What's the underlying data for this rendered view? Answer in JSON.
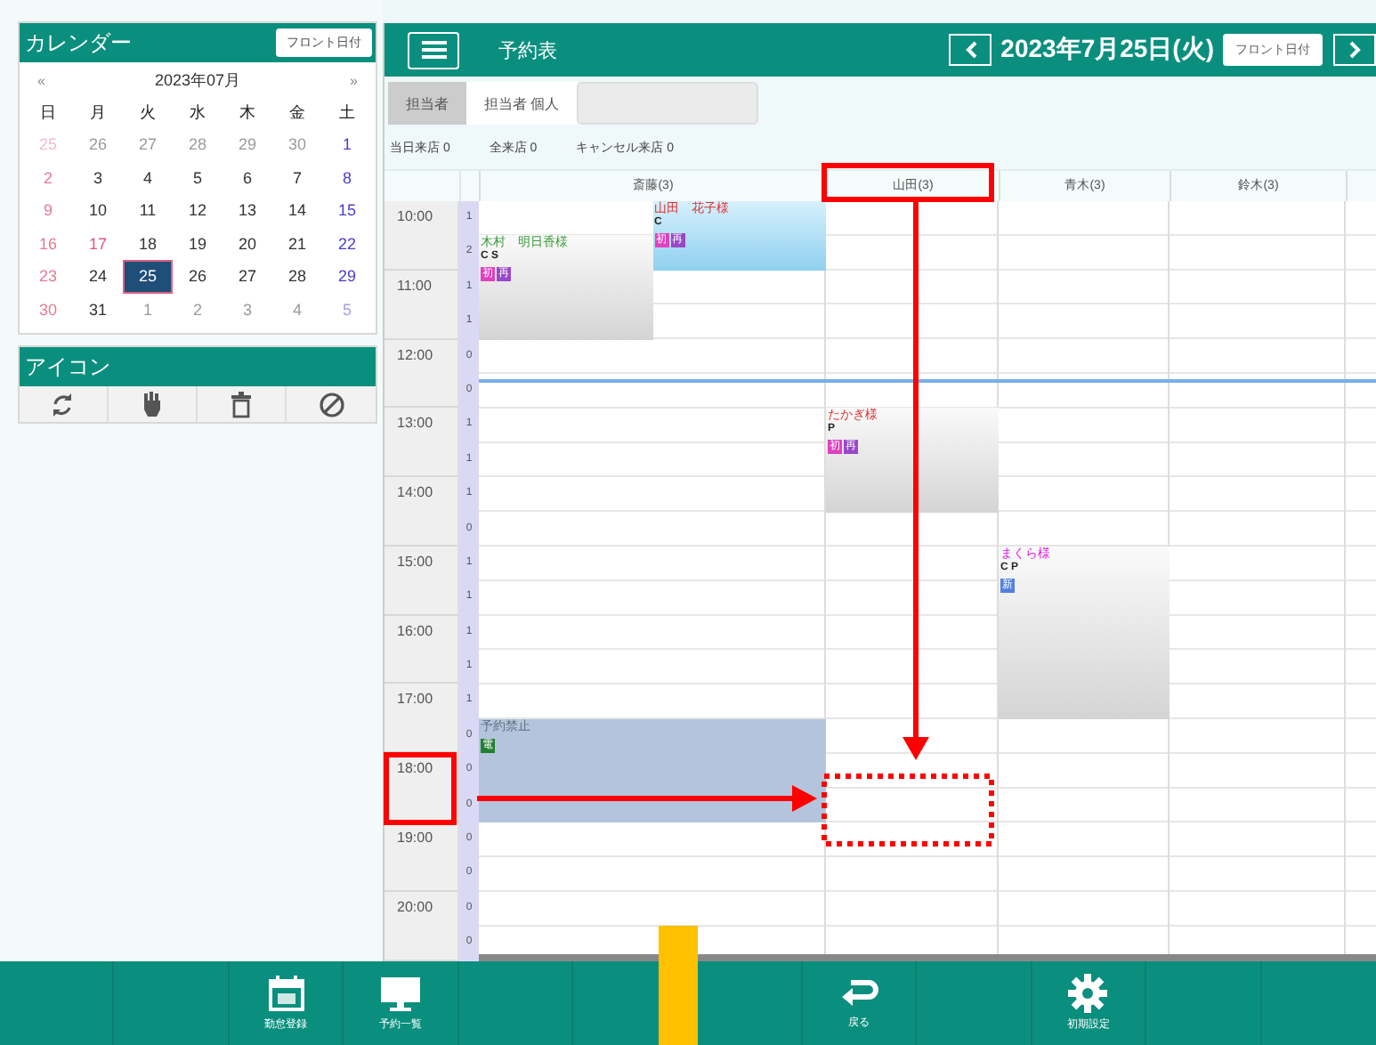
{
  "calendar": {
    "title": "カレンダー",
    "today_button": "フロント日付",
    "prev": "«",
    "next": "»",
    "month": "2023年07月",
    "weekdays": [
      "日",
      "月",
      "火",
      "水",
      "木",
      "金",
      "土"
    ],
    "days": [
      {
        "label": "25",
        "kind": "sun",
        "muted": true,
        "selected": false
      },
      {
        "label": "26",
        "kind": "weekday",
        "muted": true,
        "selected": false
      },
      {
        "label": "27",
        "kind": "weekday",
        "muted": true,
        "selected": false
      },
      {
        "label": "28",
        "kind": "weekday",
        "muted": true,
        "selected": false
      },
      {
        "label": "29",
        "kind": "weekday",
        "muted": true,
        "selected": false
      },
      {
        "label": "30",
        "kind": "weekday",
        "muted": true,
        "selected": false
      },
      {
        "label": "1",
        "kind": "sat",
        "muted": false,
        "selected": false
      },
      {
        "label": "2",
        "kind": "sun",
        "muted": false,
        "selected": false
      },
      {
        "label": "3",
        "kind": "weekday",
        "muted": false,
        "selected": false
      },
      {
        "label": "4",
        "kind": "weekday",
        "muted": false,
        "selected": false
      },
      {
        "label": "5",
        "kind": "weekday",
        "muted": false,
        "selected": false
      },
      {
        "label": "6",
        "kind": "weekday",
        "muted": false,
        "selected": false
      },
      {
        "label": "7",
        "kind": "weekday",
        "muted": false,
        "selected": false
      },
      {
        "label": "8",
        "kind": "sat",
        "muted": false,
        "selected": false
      },
      {
        "label": "9",
        "kind": "sun",
        "muted": false,
        "selected": false
      },
      {
        "label": "10",
        "kind": "weekday",
        "muted": false,
        "selected": false
      },
      {
        "label": "11",
        "kind": "weekday",
        "muted": false,
        "selected": false
      },
      {
        "label": "12",
        "kind": "weekday",
        "muted": false,
        "selected": false
      },
      {
        "label": "13",
        "kind": "weekday",
        "muted": false,
        "selected": false
      },
      {
        "label": "14",
        "kind": "weekday",
        "muted": false,
        "selected": false
      },
      {
        "label": "15",
        "kind": "sat",
        "muted": false,
        "selected": false
      },
      {
        "label": "16",
        "kind": "sun",
        "muted": false,
        "selected": false
      },
      {
        "label": "17",
        "kind": "holiday",
        "muted": false,
        "selected": false
      },
      {
        "label": "18",
        "kind": "weekday",
        "muted": false,
        "selected": false
      },
      {
        "label": "19",
        "kind": "weekday",
        "muted": false,
        "selected": false
      },
      {
        "label": "20",
        "kind": "weekday",
        "muted": false,
        "selected": false
      },
      {
        "label": "21",
        "kind": "weekday",
        "muted": false,
        "selected": false
      },
      {
        "label": "22",
        "kind": "sat",
        "muted": false,
        "selected": false
      },
      {
        "label": "23",
        "kind": "sun",
        "muted": false,
        "selected": false
      },
      {
        "label": "24",
        "kind": "weekday",
        "muted": false,
        "selected": false
      },
      {
        "label": "25",
        "kind": "weekday",
        "muted": false,
        "selected": true
      },
      {
        "label": "26",
        "kind": "weekday",
        "muted": false,
        "selected": false
      },
      {
        "label": "27",
        "kind": "weekday",
        "muted": false,
        "selected": false
      },
      {
        "label": "28",
        "kind": "weekday",
        "muted": false,
        "selected": false
      },
      {
        "label": "29",
        "kind": "sat",
        "muted": false,
        "selected": false
      },
      {
        "label": "30",
        "kind": "sun",
        "muted": false,
        "selected": false
      },
      {
        "label": "31",
        "kind": "weekday",
        "muted": false,
        "selected": false
      },
      {
        "label": "1",
        "kind": "weekday",
        "muted": true,
        "selected": false
      },
      {
        "label": "2",
        "kind": "weekday",
        "muted": true,
        "selected": false
      },
      {
        "label": "3",
        "kind": "weekday",
        "muted": true,
        "selected": false
      },
      {
        "label": "4",
        "kind": "weekday",
        "muted": true,
        "selected": false
      },
      {
        "label": "5",
        "kind": "sat",
        "muted": true,
        "selected": false
      }
    ]
  },
  "icon_panel": {
    "title": "アイコン",
    "icons": [
      {
        "kind": "refresh"
      },
      {
        "kind": "hand"
      },
      {
        "kind": "trash"
      },
      {
        "kind": "block"
      }
    ]
  },
  "header": {
    "title": "予約表",
    "date": "2023年7月25日(火)",
    "today_button": "フロント日付"
  },
  "tabs": [
    {
      "label": "担当者",
      "selected": true
    },
    {
      "label": "担当者 個人",
      "selected": false
    }
  ],
  "counts": [
    {
      "label": "当日来店",
      "value": "0"
    },
    {
      "label": "全来店",
      "value": "0"
    },
    {
      "label": "キャンセル来店",
      "value": "0"
    }
  ],
  "columns": [
    "斎藤(3)",
    "山田(3)",
    "青木(3)",
    "鈴木(3)"
  ],
  "rows": [
    {
      "time": "10:00",
      "count": "1"
    },
    {
      "count": "2"
    },
    {
      "time": "11:00",
      "count": "1"
    },
    {
      "count": "1"
    },
    {
      "time": "12:00",
      "count": "0"
    },
    {
      "count": "0"
    },
    {
      "time": "13:00",
      "count": "1"
    },
    {
      "count": "1"
    },
    {
      "time": "14:00",
      "count": "1"
    },
    {
      "count": "0"
    },
    {
      "time": "15:00",
      "count": "1"
    },
    {
      "count": "1"
    },
    {
      "time": "16:00",
      "count": "1"
    },
    {
      "count": "1"
    },
    {
      "time": "17:00",
      "count": "1"
    },
    {
      "count": "0"
    },
    {
      "time": "18:00",
      "count": "0"
    },
    {
      "count": "0"
    },
    {
      "time": "19:00",
      "count": "0"
    },
    {
      "count": "0"
    },
    {
      "time": "20:00",
      "count": "0"
    },
    {
      "count": "0"
    }
  ],
  "appointments": [
    {
      "kind": "reserved",
      "name": "木村　明日香様",
      "color": "#3c9a3c",
      "tags": "C S",
      "badges": [
        {
          "label": "初",
          "color": "#e040c0"
        },
        {
          "label": "再",
          "color": "#9848c8"
        }
      ]
    },
    {
      "kind": "current",
      "name": "山田　花子様",
      "color": "#e03030",
      "tags": "C",
      "badges": [
        {
          "label": "初",
          "color": "#e040c0"
        },
        {
          "label": "再",
          "color": "#9848c8"
        }
      ]
    },
    {
      "kind": "reserved",
      "name": "たかぎ様",
      "color": "#e03030",
      "tags": "P",
      "badges": [
        {
          "label": "初",
          "color": "#e040c0"
        },
        {
          "label": "再",
          "color": "#9848c8"
        }
      ]
    },
    {
      "kind": "reserved",
      "name": "まくら様",
      "color": "#e020e0",
      "tags": "C P",
      "badges": [
        {
          "label": "新",
          "color": "#5080e0"
        }
      ]
    },
    {
      "kind": "blocked",
      "name": "予約禁止",
      "color": "#607080",
      "badges": [
        {
          "label": "電",
          "color": "#208030"
        }
      ]
    }
  ],
  "footer": [
    {
      "kind": "blank"
    },
    {
      "kind": "blank"
    },
    {
      "kind": "calendar",
      "label": "勤怠登録"
    },
    {
      "kind": "monitor",
      "label": "予約一覧"
    },
    {
      "kind": "blank"
    },
    {
      "kind": "blank"
    },
    {
      "kind": "blank"
    },
    {
      "kind": "return",
      "label": "戻る"
    },
    {
      "kind": "blank"
    },
    {
      "kind": "gear",
      "label": "初期設定"
    },
    {
      "kind": "blank"
    },
    {
      "kind": "blank"
    }
  ],
  "annotations": [
    {
      "kind": "header-frame"
    },
    {
      "kind": "time-frame"
    },
    {
      "kind": "down-arrow"
    },
    {
      "kind": "right-arrow"
    },
    {
      "kind": "target-frame"
    },
    {
      "kind": "marker"
    }
  ]
}
